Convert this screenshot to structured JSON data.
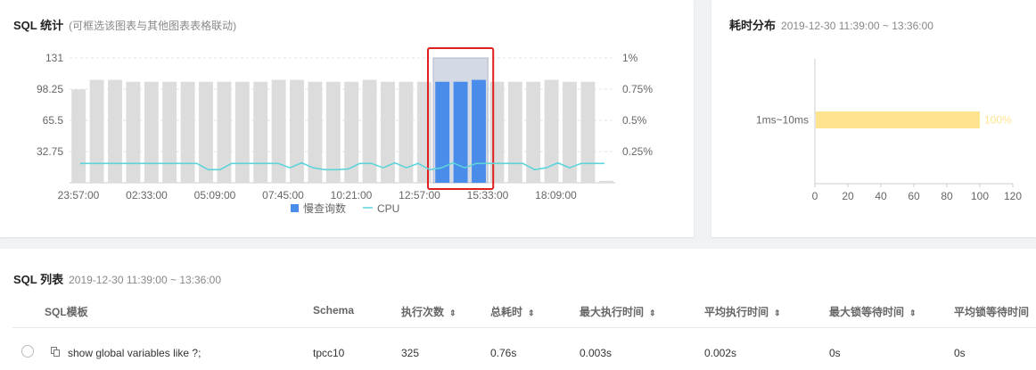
{
  "stats": {
    "title": "SQL 统计",
    "subtitle": "(可框选该图表与其他图表表格联动)",
    "legend": {
      "slow_query": "慢查询数",
      "cpu": "CPU"
    }
  },
  "chart_data": [
    {
      "type": "bar",
      "title": "SQL 统计",
      "x_ticks": [
        "23:57:00",
        "02:33:00",
        "05:09:00",
        "07:45:00",
        "10:21:00",
        "12:57:00",
        "15:33:00",
        "18:09:00"
      ],
      "y_left_ticks": [
        "131",
        "98.25",
        "65.5",
        "32.75"
      ],
      "y_right_ticks": [
        "1%",
        "0.75%",
        "0.5%",
        "0.25%"
      ],
      "ylim": [
        0,
        131
      ],
      "y2lim": [
        0,
        1
      ],
      "grid": true,
      "legend_position": "bottom",
      "series": [
        {
          "name": "慢查询数",
          "color": "#dcdcdc",
          "highlight_color": "#4a8cea",
          "values": [
            98,
            108,
            108,
            104,
            108,
            108,
            106,
            106,
            106,
            106,
            106,
            106,
            106,
            108,
            106,
            106,
            106,
            106,
            106,
            106,
            106,
            108,
            108,
            106,
            108,
            106,
            106,
            106,
            106,
            106,
            106,
            106,
            108,
            106,
            106,
            106,
            106,
            106,
            106,
            108,
            106,
            106,
            106,
            106,
            108,
            106,
            106,
            106,
            106,
            106,
            106,
            106,
            108,
            106,
            106,
            106,
            106,
            106,
            106,
            106,
            106,
            108,
            106,
            106,
            106,
            106,
            2
          ]
        },
        {
          "name": "CPU",
          "color": "#5dd4d9",
          "values": [
            0.155,
            0.155,
            0.155,
            0.155,
            0.155,
            0.155,
            0.155,
            0.155,
            0.155,
            0.155,
            0.155,
            0.105,
            0.105,
            0.155,
            0.155,
            0.155,
            0.155,
            0.155,
            0.12,
            0.16,
            0.12,
            0.105,
            0.105,
            0.11,
            0.155,
            0.155,
            0.12,
            0.16,
            0.12,
            0.155,
            0.105,
            0.12,
            0.16,
            0.12,
            0.155,
            0.155,
            0.155,
            0.155,
            0.155,
            0.105,
            0.12,
            0.16,
            0.12,
            0.155,
            0.155,
            0.155
          ]
        }
      ],
      "selection": {
        "from_bar": 20,
        "to_bar": 22,
        "color": "#e02020"
      }
    },
    {
      "type": "bar",
      "orientation": "horizontal",
      "title": "耗时分布",
      "categories": [
        "1ms~10ms"
      ],
      "values": [
        100
      ],
      "value_labels": [
        "100%"
      ],
      "xlim": [
        0,
        120
      ],
      "x_ticks": [
        "0",
        "20",
        "40",
        "60",
        "80",
        "100",
        "120"
      ],
      "color": "#ffe48f"
    }
  ],
  "distribution": {
    "title": "耗时分布",
    "time_range": "2019-12-30 11:39:00 ~ 13:36:00"
  },
  "list": {
    "title": "SQL 列表",
    "time_range": "2019-12-30 11:39:00 ~ 13:36:00",
    "columns": [
      "SQL模板",
      "Schema",
      "执行次数",
      "总耗时",
      "最大执行时间",
      "平均执行时间",
      "最大锁等待时间",
      "平均锁等待时间"
    ],
    "sort_icon": "⇕",
    "rows": [
      {
        "sql": "show global variables like ?;",
        "schema": "tpcc10",
        "count": "325",
        "total": "0.76s",
        "max_exec": "0.003s",
        "avg_exec": "0.002s",
        "max_lock": "0s",
        "avg_lock": "0s"
      }
    ]
  }
}
